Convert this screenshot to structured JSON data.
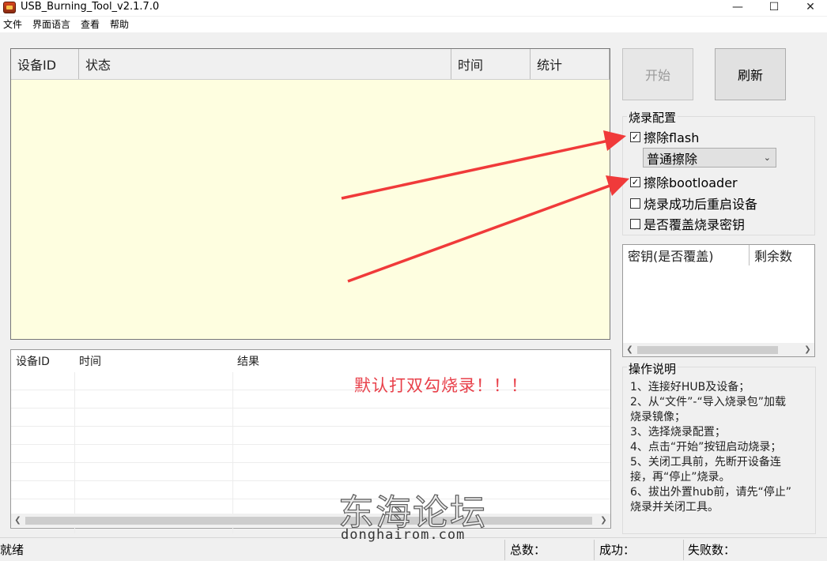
{
  "window": {
    "title": "USB_Burning_Tool_v2.1.7.0",
    "controls": {
      "minimize": "—",
      "maximize": "☐",
      "close": "✕"
    }
  },
  "menu": [
    "文件",
    "界面语言",
    "查看",
    "帮助"
  ],
  "device_table": {
    "columns": [
      "设备ID",
      "状态",
      "时间",
      "统计"
    ]
  },
  "buttons": {
    "start": "开始",
    "refresh": "刷新"
  },
  "burn_config": {
    "title": "烧录配置",
    "erase_flash": {
      "label": "擦除flash",
      "checked": true
    },
    "erase_mode": {
      "selected": "普通擦除"
    },
    "erase_bootloader": {
      "label": "擦除bootloader",
      "checked": true
    },
    "reboot_after": {
      "label": "烧录成功后重启设备",
      "checked": false
    },
    "overwrite_key": {
      "label": "是否覆盖烧录密钥",
      "checked": false
    }
  },
  "key_table": {
    "columns": [
      "密钥(是否覆盖)",
      "剩余数"
    ]
  },
  "result_table": {
    "columns": [
      "设备ID",
      "时间",
      "结果"
    ]
  },
  "annotation": "默认打双勾烧录！！！",
  "instructions": {
    "title": "操作说明",
    "lines": [
      "1、连接好HUB及设备；",
      "2、从“文件”-“导入烧录包”加载",
      "烧录镜像；",
      "3、选择烧录配置；",
      "4、点击“开始”按钮启动烧录；",
      "5、关闭工具前，先断开设备连",
      "接，再“停止”烧录。",
      "6、拔出外置hub前，请先“停止”",
      "烧录并关闭工具。"
    ]
  },
  "status_bar": {
    "state": "就绪",
    "total_label": "总数：",
    "success_label": "成功：",
    "fail_label": "失败数："
  },
  "watermark": {
    "chinese": "东海论坛",
    "url": "donghairom.com"
  },
  "colors": {
    "grid_background": "#fefee0",
    "arrow": "#f03a3a",
    "annotation": "#e8404a"
  }
}
